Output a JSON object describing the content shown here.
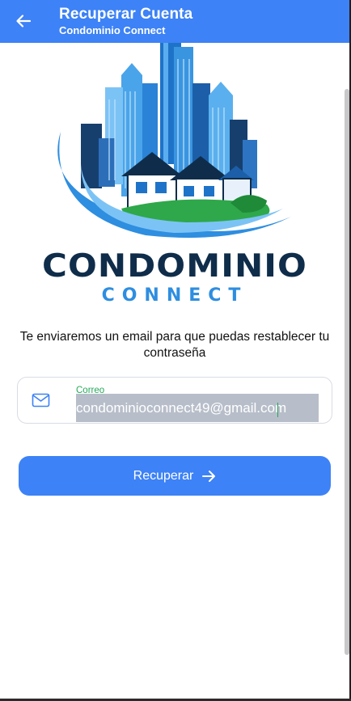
{
  "appbar": {
    "title": "Recuperar Cuenta",
    "subtitle": "Condominio Connect",
    "back_icon": "arrow-left-icon"
  },
  "logo": {
    "main": "CONDOMINIO",
    "sub": "CONNECT"
  },
  "description": "Te enviaremos un email para que puedas restablecer tu contraseña",
  "email_field": {
    "icon": "mail-icon",
    "label": "Correo",
    "value": "condominioconnect49@gmail.com"
  },
  "recover_button": {
    "label": "Recuperar",
    "icon": "arrow-right-icon"
  },
  "colors": {
    "primary": "#3d82f6",
    "label_green": "#25a95a",
    "logo_navy": "#0f2d4a",
    "logo_blue": "#2e8ee0"
  }
}
